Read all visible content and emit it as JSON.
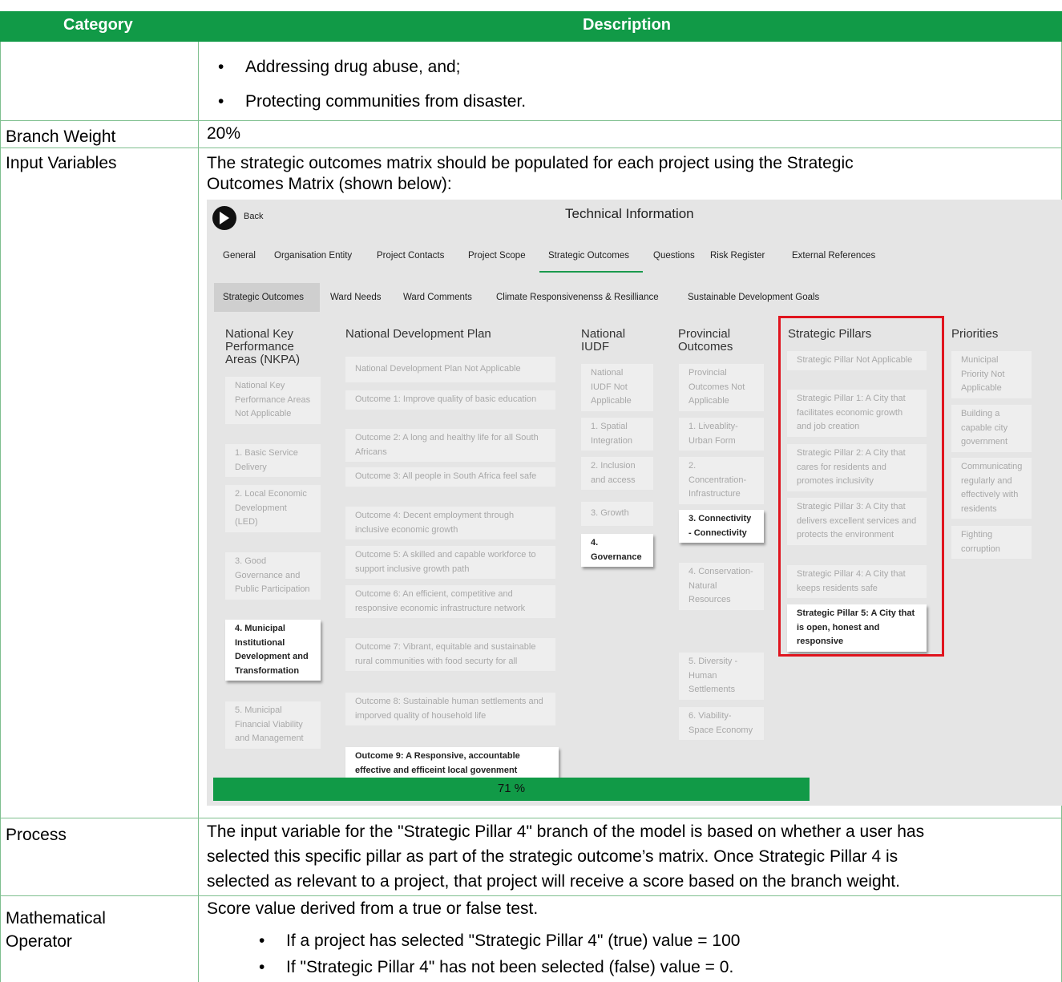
{
  "table": {
    "header": {
      "category": "Category",
      "description": "Description"
    },
    "bullets_top": [
      "Addressing drug abuse, and;",
      "Protecting communities from disaster."
    ],
    "branch_weight": {
      "label": "Branch Weight",
      "value": "20%"
    },
    "input_variables": {
      "label": "Input Variables",
      "line1": "The strategic outcomes matrix should be populated for each project using the Strategic",
      "line2": "Outcomes Matrix (shown below):"
    },
    "process": {
      "label": "Process",
      "line1": "The input variable for the \"Strategic Pillar 4\" branch of the model is based on whether a user has",
      "line2": "selected this specific pillar as part of the strategic outcome’s matrix. Once Strategic Pillar 4 is",
      "line3": "selected as relevant to a project, that project will receive a score based on the branch weight."
    },
    "math": {
      "label1": "Mathematical",
      "label2": "Operator",
      "line1": "Score value derived from a true or false test.",
      "bullet1": "If a project has selected \"Strategic Pillar 4\" (true) value = 100",
      "bullet2": "If \"Strategic Pillar 4\" has not been selected (false) value = 0."
    }
  },
  "screenshot": {
    "title": "Technical Information",
    "back_label": "Back",
    "tabs": [
      "General",
      "Organisation Entity",
      "Project Contacts",
      "Project Scope",
      "Strategic Outcomes",
      "Questions",
      "Risk Register",
      "External References"
    ],
    "subtabs": [
      "Strategic Outcomes",
      "Ward Needs",
      "Ward Comments",
      "Climate Responsivenenss & Resilliance",
      "Sustainable Development Goals"
    ],
    "columns": {
      "nkpa": {
        "heading": "National Key Performance Areas (NKPA)",
        "items": [
          "National Key Performance Areas Not Applicable",
          "1. Basic Service Delivery",
          "2. Local Economic Development (LED)",
          "3. Good Governance and Public Participation",
          "4. Municipal Institutional Development and Transformation",
          "5. Municipal Financial Viability and Management"
        ]
      },
      "ndp": {
        "heading": "National Development Plan",
        "items": [
          "National Development Plan Not Applicable",
          "Outcome 1: Improve quality of basic education",
          "Outcome 2: A long and healthy life for all South Africans",
          "Outcome 3: All people in South Africa feel safe",
          "Outcome 4: Decent employment through inclusive economic growth",
          "Outcome 5: A skilled and capable workforce to support inclusive growth path",
          "Outcome 6: An efficient, competitive and responsive economic infrastructure network",
          "Outcome 7: Vibrant, equitable and sustainable rural communities with food securty for all",
          "Outcome 8: Sustainable human settlements and imporved quality of household life",
          "Outcome 9: A Responsive, accountable effective and efficeint local govenment"
        ]
      },
      "iudf": {
        "heading": "National IUDF",
        "items": [
          "National IUDF Not Applicable",
          "1. Spatial Integration",
          "2. Inclusion and access",
          "3. Growth",
          "4. Governance"
        ]
      },
      "provincial": {
        "heading": "Provincial Outcomes",
        "items": [
          "Provincial Outcomes Not Applicable",
          "1. Liveablity- Urban Form",
          "2. Concentration- Infrastructure",
          "3. Connectivity - Connectivity",
          "4. Conservation- Natural Resources",
          "5. Diversity - Human Settlements",
          "6. Viability- Space Economy"
        ]
      },
      "pillars": {
        "heading": "Strategic Pillars",
        "items": [
          "Strategic Pillar Not Applicable",
          "Strategic Pillar 1: A City that facilitates economic growth and job creation",
          "Strategic Pillar 2: A City that cares for residents and promotes inclusivity",
          "Strategic Pillar 3: A City that delivers excellent services and protects the environment",
          "Strategic Pillar 4: A City that keeps residents safe",
          "Strategic Pillar 5: A City that is open, honest and responsive"
        ]
      },
      "priorities": {
        "heading": "Priorities",
        "items": [
          "Municipal Priority Not Applicable",
          "Building a capable city government",
          "Communicating regularly and effectively with residents",
          "Fighting corruption"
        ]
      }
    },
    "progress": {
      "label": "71 %",
      "value": 0.71
    },
    "colors": {
      "accent": "#119a47",
      "highlight": "#e0141e"
    }
  }
}
